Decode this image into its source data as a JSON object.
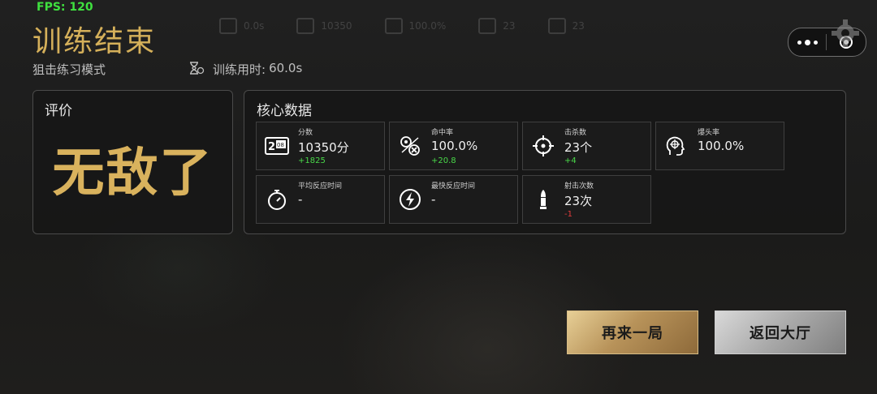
{
  "hud": {
    "fps": "FPS: 120"
  },
  "header": {
    "title": "训练结束",
    "mode": "狙击练习模式",
    "time_label": "训练用时:",
    "time_value": "60.0s"
  },
  "evaluation": {
    "title": "评价",
    "grade": "无敌了"
  },
  "core": {
    "title": "核心数据",
    "stats": [
      {
        "label": "分数",
        "value": "10350分",
        "delta": "+1825",
        "delta_type": "positive",
        "icon": "scoreboard-icon"
      },
      {
        "label": "命中率",
        "value": "100.0%",
        "delta": "+20.8",
        "delta_type": "positive",
        "icon": "hit-rate-icon"
      },
      {
        "label": "击杀数",
        "value": "23个",
        "delta": "+4",
        "delta_type": "positive",
        "icon": "crosshair-icon"
      },
      {
        "label": "爆头率",
        "value": "100.0%",
        "delta": "",
        "delta_type": "none",
        "icon": "headshot-icon"
      },
      {
        "label": "平均反应时间",
        "value": "-",
        "delta": "",
        "delta_type": "none",
        "icon": "stopwatch-icon"
      },
      {
        "label": "最快反应时间",
        "value": "-",
        "delta": "",
        "delta_type": "none",
        "icon": "lightning-icon"
      },
      {
        "label": "射击次数",
        "value": "23次",
        "delta": "-1",
        "delta_type": "negative",
        "icon": "bullet-icon"
      }
    ]
  },
  "buttons": {
    "play_again": "再来一局",
    "back_lobby": "返回大厅"
  },
  "colors": {
    "gold": "#d5b05a",
    "positive": "#49d949",
    "negative": "#e23b3b",
    "fps_green": "#3fe03f"
  }
}
